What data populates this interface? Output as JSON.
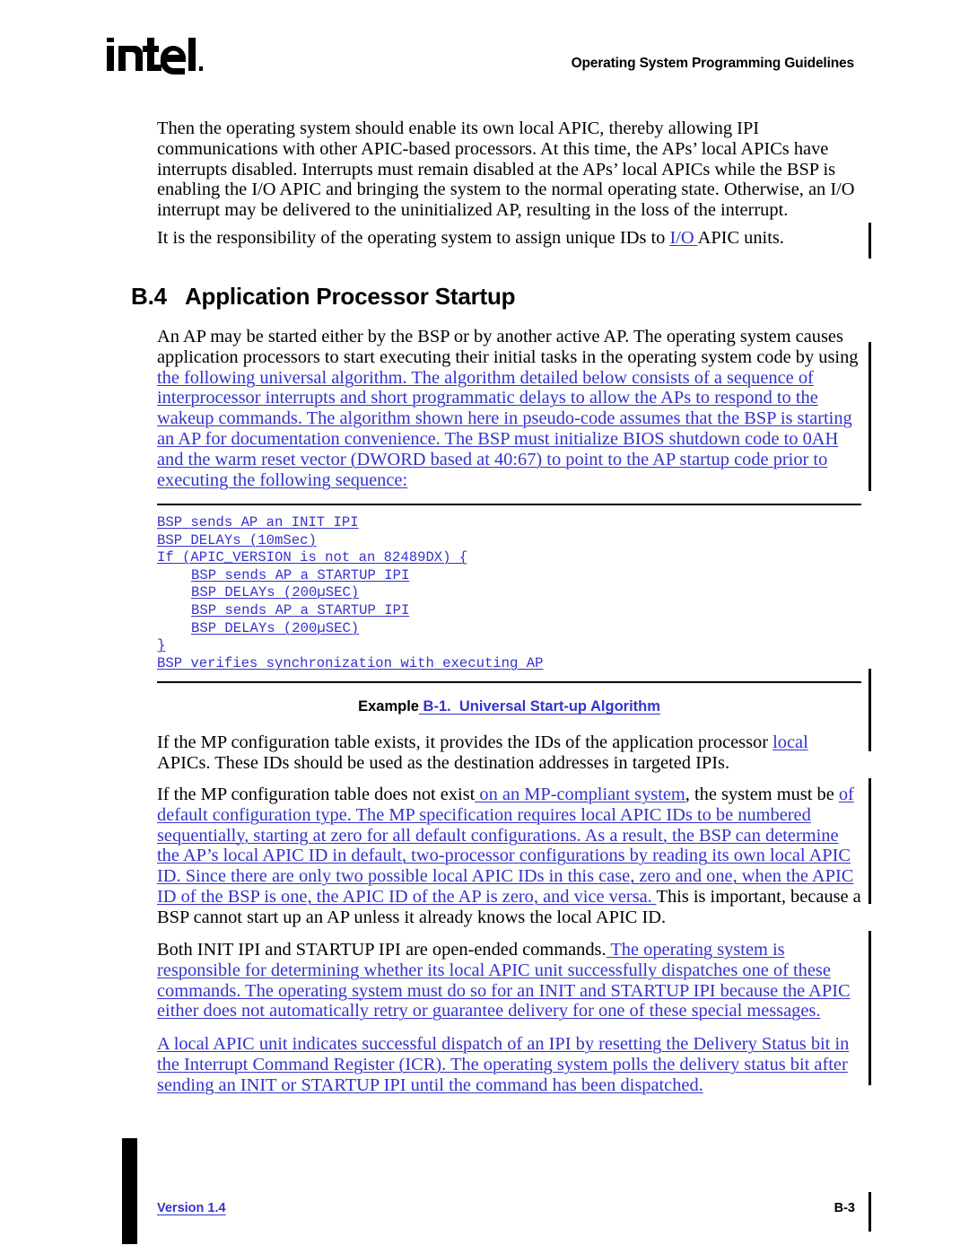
{
  "header": {
    "logo_text": "intel",
    "title": "Operating System Programming Guidelines"
  },
  "colors": {
    "revision_blue": "#3333CC",
    "body_black": "#000000",
    "page_background": "#FFFFFF"
  },
  "body": {
    "para_1": "Then the operating system should enable its own local APIC, thereby allowing IPI communications with other APIC-based processors.  At this time, the APs’ local APICs have interrupts disabled. Interrupts must remain disabled at the APs’ local APICs while the BSP is enabling the I/O APIC and bringing the system to the normal operating state.  Otherwise, an I/O interrupt may be delivered to the uninitialized AP, resulting in the loss of the interrupt.",
    "para_2_black_a": "It is the responsibility of the operating system to assign unique IDs to ",
    "para_2_blue": "I/O ",
    "para_2_black_b": "APIC units."
  },
  "section": {
    "number": "B.4",
    "title": "Application Processor Startup",
    "heading_full": "B.4   Application Processor Startup"
  },
  "intro": {
    "black_part": "An AP may be started either by the BSP or by another active AP.  The operating system causes application processors to start executing their initial tasks in the operating system code by using ",
    "blue_part": "the following universal algorithm. The algorithm detailed below consists of a sequence of interprocessor interrupts and short programmatic delays to allow the APs to respond to the wakeup commands. The algorithm shown here in pseudo-code assumes that the BSP is starting an AP for documentation convenience. The BSP must initialize BIOS shutdown code to 0AH and the warm reset vector (DWORD based at 40:67) to point to the AP startup code prior to executing the following sequence:"
  },
  "code_example": {
    "lines": [
      {
        "text": "BSP sends AP an INIT IPI",
        "indent": false
      },
      {
        "text": "BSP DELAYs (10mSec)",
        "indent": false
      },
      {
        "text": "If (APIC_VERSION is not an 82489DX) {",
        "indent": false
      },
      {
        "text": "BSP sends AP a STARTUP IPI",
        "indent": true
      },
      {
        "text": "BSP DELAYs (200µSEC)",
        "indent": true
      },
      {
        "text": "BSP sends AP a STARTUP IPI",
        "indent": true
      },
      {
        "text": "BSP DELAYs (200µSEC)",
        "indent": true
      },
      {
        "text": "}",
        "indent": false
      },
      {
        "text": "BSP verifies synchronization with executing AP",
        "indent": false
      }
    ],
    "caption_label": "Example",
    "caption_number_title": " B-1.  Universal Start-up Algorithm"
  },
  "paragraphs": {
    "mp_exists_a": "If the MP configuration table exists, it provides the IDs of the application processor ",
    "mp_exists_blue": "local ",
    "mp_exists_b": "APICs. These IDs should be used as the destination addresses in targeted IPIs.",
    "mp_not_exist_a": "If the MP configuration table does not exist",
    "mp_not_exist_blue_1": " on an MP-compliant system",
    "mp_not_exist_b": ", the system must be ",
    "mp_not_exist_blue_2": "of default configuration type. The MP specification requires local APIC IDs to be numbered sequentially, starting at zero for all default configurations.  As a result, the BSP can determine the AP’s local APIC ID in default, two-processor configurations by reading its own local APIC ID. Since there are only two possible local APIC IDs in this case, zero and one, when the APIC ID of the BSP is one, the APIC ID of the AP is zero, and vice versa. ",
    "mp_not_exist_c": " This is important, because a BSP cannot start up an AP unless it already knows the local APIC ID.",
    "ipi_black": "Both INIT IPI and STARTUP IPI are open-ended commands.",
    "ipi_blue": " The operating system is responsible for determining whether its local APIC unit successfully dispatches one of these commands. The operating system must do so for an INIT and STARTUP IPI because the APIC either does not automatically retry or guarantee delivery for one of these special messages.",
    "delivery_blue": "A local APIC unit indicates successful dispatch of an IPI by resetting the Delivery Status bit in the Interrupt Command Register (ICR).  The operating system polls the delivery status bit after sending an INIT or STARTUP IPI until the command has been dispatched."
  },
  "footer": {
    "version": "Version 1.4",
    "page_number": "B-3"
  }
}
